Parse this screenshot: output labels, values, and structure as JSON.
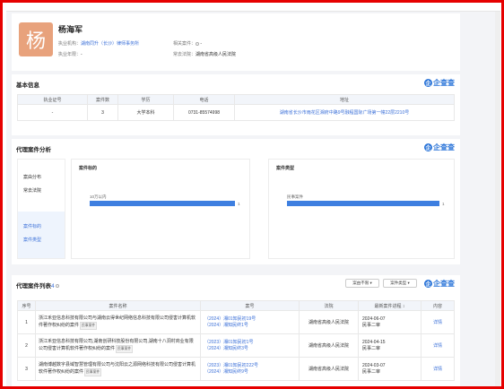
{
  "profile": {
    "avatar_char": "杨",
    "name": "杨海军",
    "firm_label": "执业机构：",
    "firm": "湖南同升（长沙）律师事务所",
    "years_label": "执业年限：",
    "years": "-",
    "related_label": "相关案件：",
    "related_value": "-",
    "court_label": "常去法院：",
    "court": "湖南省高级人民法院"
  },
  "logo": {
    "icon": "企",
    "text": "企查查"
  },
  "basic": {
    "title": "基本信息",
    "headers": [
      "执业证号",
      "案件数",
      "学历",
      "电话",
      "地址"
    ],
    "row": [
      "-",
      "3",
      "大学本科",
      "0731-85574998",
      "湖南省长沙市雨花区湘府中路9号融程国际广场第一幢22层2210号"
    ]
  },
  "analysis": {
    "title": "代理案件分析",
    "tabs": [
      "案由分布",
      "常去法院",
      "案件标的",
      "案件类型"
    ],
    "chart1": {
      "heading": "案件标的",
      "chart_data": {
        "type": "bar",
        "categories": [
          "10万以内"
        ],
        "values": [
          1
        ],
        "xlim": [
          0,
          1
        ]
      }
    },
    "chart2": {
      "heading": "案件类型",
      "chart_data": {
        "type": "bar",
        "categories": [
          "民事案件"
        ],
        "values": [
          1
        ],
        "xlim": [
          0,
          1
        ]
      }
    }
  },
  "cases": {
    "title": "代理案件列表",
    "count": "4",
    "filter1": "案由不限 ▾",
    "filter2": "案件类型 ▾",
    "headers": [
      "序号",
      "案件名称",
      "案号",
      "法院",
      "最新案件进程 ↕",
      "内容"
    ],
    "rows": [
      {
        "no": "1",
        "name": "浙江禾亚信息科技有限公司与湖南云得世纪网络信息科技有限公司侵害计算机软件著作权纠纷的案件",
        "badge": "民事案件",
        "case_nos": [
          "（2024）湘01知民初19号",
          "（2024）湘知民终1号"
        ],
        "court": "湖南省高级人民法院",
        "date": "2024-06-07",
        "stage": "民事二审",
        "action": "详情"
      },
      {
        "no": "2",
        "name": "浙江禾亚信息科技有限公司,湖南创研科技股份有限公司,湖南十八洞村商业有限公司侵害计算机软件著作权纠纷的案件",
        "badge": "民事案件",
        "case_nos": [
          "（2023）湘01知民初1号",
          "（2024）湘知民终3号"
        ],
        "court": "湖南省高级人民法院",
        "date": "2024-04-15",
        "stage": "民事二审",
        "action": "详情"
      },
      {
        "no": "3",
        "name": "湖南博越数字县域智慧管理有限公司与沈阳云之源网络科技有限公司侵害计算机软件著作权纠纷的案件",
        "badge": "民事案件",
        "case_nos": [
          "（2023）湘01知民初222号",
          "（2024）湘知民终9号"
        ],
        "court": "湖南省高级人民法院",
        "date": "2024-03-07",
        "stage": "民事二审",
        "action": "详情"
      }
    ]
  }
}
